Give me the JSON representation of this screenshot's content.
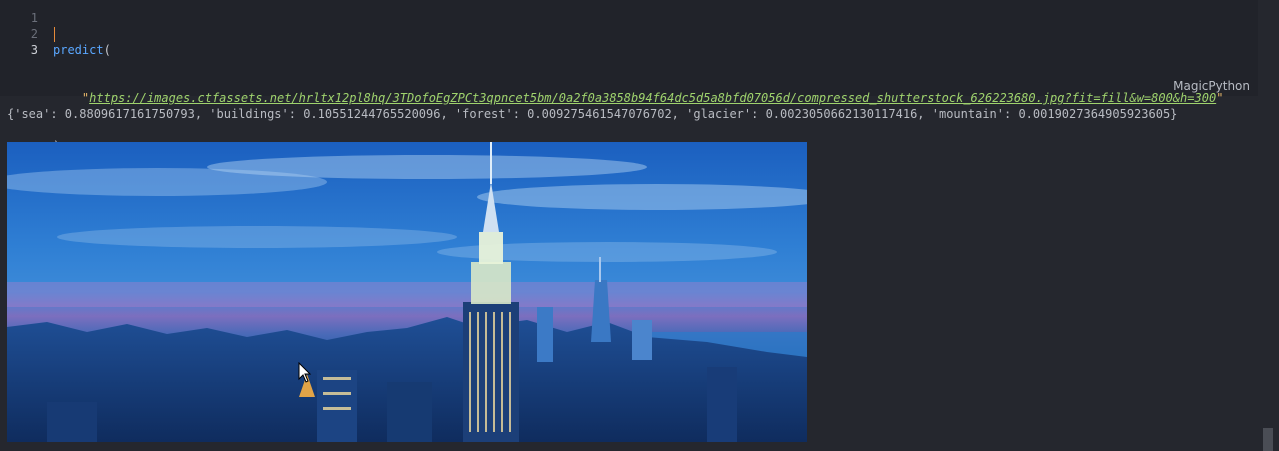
{
  "editor": {
    "line_numbers": [
      "1",
      "2",
      "3"
    ],
    "line1": {
      "fn": "predict",
      "open": "("
    },
    "line2": {
      "indent": "    ",
      "quote_open": "\"",
      "url": "https://images.ctfassets.net/hrltx12pl8hq/3TDofoEgZPCt3qpncet5bm/0a2f0a3858b94f64dc5d5a8bfd07056d/compressed_shutterstock_626223680.jpg?fit=fill&w=800&h=300",
      "quote_close": "\""
    },
    "line3": {
      "close": ")"
    },
    "language": "MagicPython"
  },
  "output": {
    "text": "{'sea': 0.8809617161750793, 'buildings': 0.10551244765520096, 'forest': 0.009275461547076702, 'glacier': 0.0023050662130117416, 'mountain': 0.0019027364905923605}"
  },
  "colors": {
    "background": "#25272e",
    "cell_background": "#21232a",
    "function": "#5aa7ff",
    "string": "#9fd36d",
    "quote": "#e8b86a"
  },
  "icons": {
    "mouse_pointer": "arrow-cursor-icon"
  }
}
